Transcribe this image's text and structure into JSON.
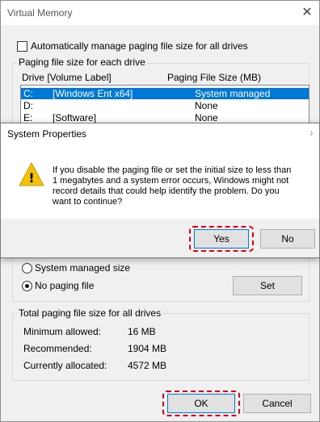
{
  "window": {
    "title": "Virtual Memory",
    "close_glyph": "✕",
    "auto_manage_label": "Automatically manage paging file size for all drives"
  },
  "paging_group": {
    "legend": "Paging file size for each drive",
    "headers": {
      "drive": "Drive  [Volume Label]",
      "size": "Paging File Size (MB)"
    },
    "rows": [
      {
        "drive": "C:",
        "label": "[Windows Ent x64]",
        "size": "System managed"
      },
      {
        "drive": "D:",
        "label": "",
        "size": "None"
      },
      {
        "drive": "E:",
        "label": "[Software]",
        "size": "None"
      }
    ],
    "system_managed_label": "System managed size",
    "no_paging_label": "No paging file",
    "set_button": "Set"
  },
  "total_group": {
    "legend": "Total paging file size for all drives",
    "minimum_label": "Minimum allowed:",
    "minimum_value": "16 MB",
    "recommended_label": "Recommended:",
    "recommended_value": "1904 MB",
    "allocated_label": "Currently allocated:",
    "allocated_value": "4572 MB"
  },
  "buttons": {
    "ok": "OK",
    "cancel": "Cancel"
  },
  "dialog": {
    "title": "System Properties",
    "close_glyph": "›",
    "warning_glyph": "!",
    "message_lines": [
      "If you disable the paging file or set the initial size to less than",
      "1 megabytes and a system error occurs, Windows might not",
      "record details that could help identify the problem. Do you",
      "want to continue?"
    ],
    "yes": "Yes",
    "no": "No"
  },
  "colors": {
    "highlight": "#e0001a",
    "selection": "#0078d7",
    "warning": "#f4c20d"
  }
}
